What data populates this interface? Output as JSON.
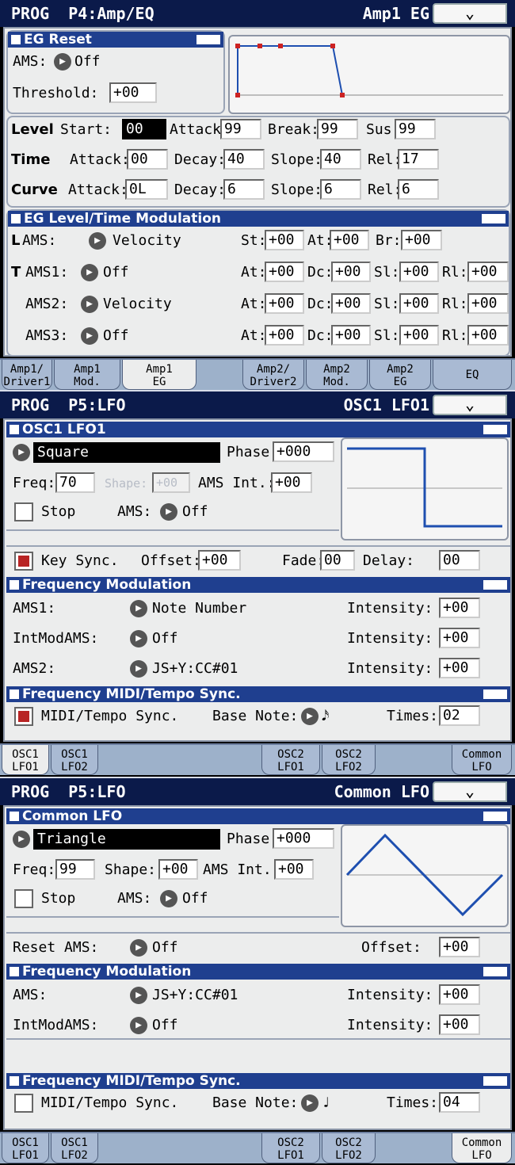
{
  "p1": {
    "title": "PROG  P4:Amp/EQ",
    "page": "Amp1 EG",
    "menu": "⌄",
    "eg_reset": {
      "header": "EG Reset",
      "ams_label": "AMS:",
      "ams_value": "Off",
      "threshold_label": "Threshold:",
      "threshold_value": "+00"
    },
    "level": {
      "label": "Level",
      "start_label": "Start:",
      "start": "00",
      "attack_label": "Attack:",
      "attack": "99",
      "break_label": "Break:",
      "break": "99",
      "sus_label": "Sus:",
      "sus": "99"
    },
    "time": {
      "label": "Time",
      "attack_label": "Attack:",
      "attack": "00",
      "decay_label": "Decay:",
      "decay": "40",
      "slope_label": "Slope:",
      "slope": "40",
      "rel_label": "Rel:",
      "rel": "17"
    },
    "curve": {
      "label": "Curve",
      "attack_label": "Attack:",
      "attack": "0L",
      "decay_label": "Decay:",
      "decay": "6",
      "slope_label": "Slope:",
      "slope": "6",
      "rel_label": "Rel:",
      "rel": "6"
    },
    "mod": {
      "header": "EG Level/Time Modulation",
      "l": {
        "prefix": "L",
        "label": "AMS:",
        "value": "Velocity",
        "st_label": "St:",
        "st": "+00",
        "at_label": "At:",
        "at": "+00",
        "br_label": "Br:",
        "br": "+00"
      },
      "rows": [
        {
          "prefix": "T",
          "label": "AMS1:",
          "value": "Off",
          "at": "+00",
          "dc": "+00",
          "sl": "+00",
          "rl": "+00"
        },
        {
          "prefix": "",
          "label": "AMS2:",
          "value": "Velocity",
          "at": "+00",
          "dc": "+00",
          "sl": "+00",
          "rl": "+00"
        },
        {
          "prefix": "",
          "label": "AMS3:",
          "value": "Off",
          "at": "+00",
          "dc": "+00",
          "sl": "+00",
          "rl": "+00"
        }
      ],
      "at_label": "At:",
      "dc_label": "Dc:",
      "sl_label": "Sl:",
      "rl_label": "Rl:"
    },
    "tabs": [
      {
        "l1": "Amp1/",
        "l2": "Driver1"
      },
      {
        "l1": "Amp1",
        "l2": "Mod."
      },
      {
        "l1": "Amp1",
        "l2": "EG"
      },
      {
        "l1": "Amp2/",
        "l2": "Driver2"
      },
      {
        "l1": "Amp2",
        "l2": "Mod."
      },
      {
        "l1": "Amp2",
        "l2": "EG"
      },
      {
        "l1": "EQ",
        "l2": ""
      }
    ]
  },
  "p2": {
    "title": "PROG  P5:LFO",
    "page": "OSC1 LFO1",
    "menu": "⌄",
    "header": "OSC1 LFO1",
    "waveform": "Square",
    "phase_label": "Phase:",
    "phase": "+000",
    "freq_label": "Freq:",
    "freq": "70",
    "shape_label": "Shape:",
    "shape": "+00",
    "ams_int_label": "AMS Int.:",
    "ams_int": "+00",
    "stop_label": "Stop",
    "ams_label": "AMS:",
    "ams": "Off",
    "keysync_label": "Key Sync.",
    "offset_label": "Offset:",
    "offset": "+00",
    "fade_label": "Fade:",
    "fade": "00",
    "delay_label": "Delay:",
    "delay": "00",
    "fm_header": "Frequency Modulation",
    "fm_rows": [
      {
        "label": "AMS1:",
        "value": "Note Number",
        "int_label": "Intensity:",
        "int": "+00"
      },
      {
        "label": "IntModAMS:",
        "value": "Off",
        "int_label": "Intensity:",
        "int": "+00"
      },
      {
        "label": "AMS2:",
        "value": "JS+Y:CC#01",
        "int_label": "Intensity:",
        "int": "+00"
      }
    ],
    "sync_header": "Frequency MIDI/Tempo Sync.",
    "sync_label": "MIDI/Tempo Sync.",
    "base_note_label": "Base Note:",
    "base_note": "𝅘𝅥𝅯",
    "times_label": "Times:",
    "times": "02",
    "tabs": [
      {
        "l1": "OSC1",
        "l2": "LFO1"
      },
      {
        "l1": "OSC1",
        "l2": "LFO2"
      },
      {
        "l1": "OSC2",
        "l2": "LFO1"
      },
      {
        "l1": "OSC2",
        "l2": "LFO2"
      },
      {
        "l1": "Common",
        "l2": "LFO"
      }
    ]
  },
  "p3": {
    "title": "PROG  P5:LFO",
    "page": "Common LFO",
    "menu": "⌄",
    "header": "Common LFO",
    "waveform": "Triangle",
    "phase_label": "Phase:",
    "phase": "+000",
    "freq_label": "Freq:",
    "freq": "99",
    "shape_label": "Shape:",
    "shape": "+00",
    "ams_int_label": "AMS Int.:",
    "ams_int": "+00",
    "stop_label": "Stop",
    "ams_label": "AMS:",
    "ams": "Off",
    "reset_ams_label": "Reset AMS:",
    "reset_ams": "Off",
    "offset_label": "Offset:",
    "offset": "+00",
    "fm_header": "Frequency Modulation",
    "fm_rows": [
      {
        "label": "AMS:",
        "value": "JS+Y:CC#01",
        "int_label": "Intensity:",
        "int": "+00"
      },
      {
        "label": "IntModAMS:",
        "value": "Off",
        "int_label": "Intensity:",
        "int": "+00"
      }
    ],
    "sync_header": "Frequency MIDI/Tempo Sync.",
    "sync_label": "MIDI/Tempo Sync.",
    "base_note_label": "Base Note:",
    "base_note": "♩",
    "times_label": "Times:",
    "times": "04",
    "tabs": [
      {
        "l1": "OSC1",
        "l2": "LFO1"
      },
      {
        "l1": "OSC1",
        "l2": "LFO2"
      },
      {
        "l1": "OSC2",
        "l2": "LFO1"
      },
      {
        "l1": "OSC2",
        "l2": "LFO2"
      },
      {
        "l1": "Common",
        "l2": "LFO"
      }
    ]
  }
}
